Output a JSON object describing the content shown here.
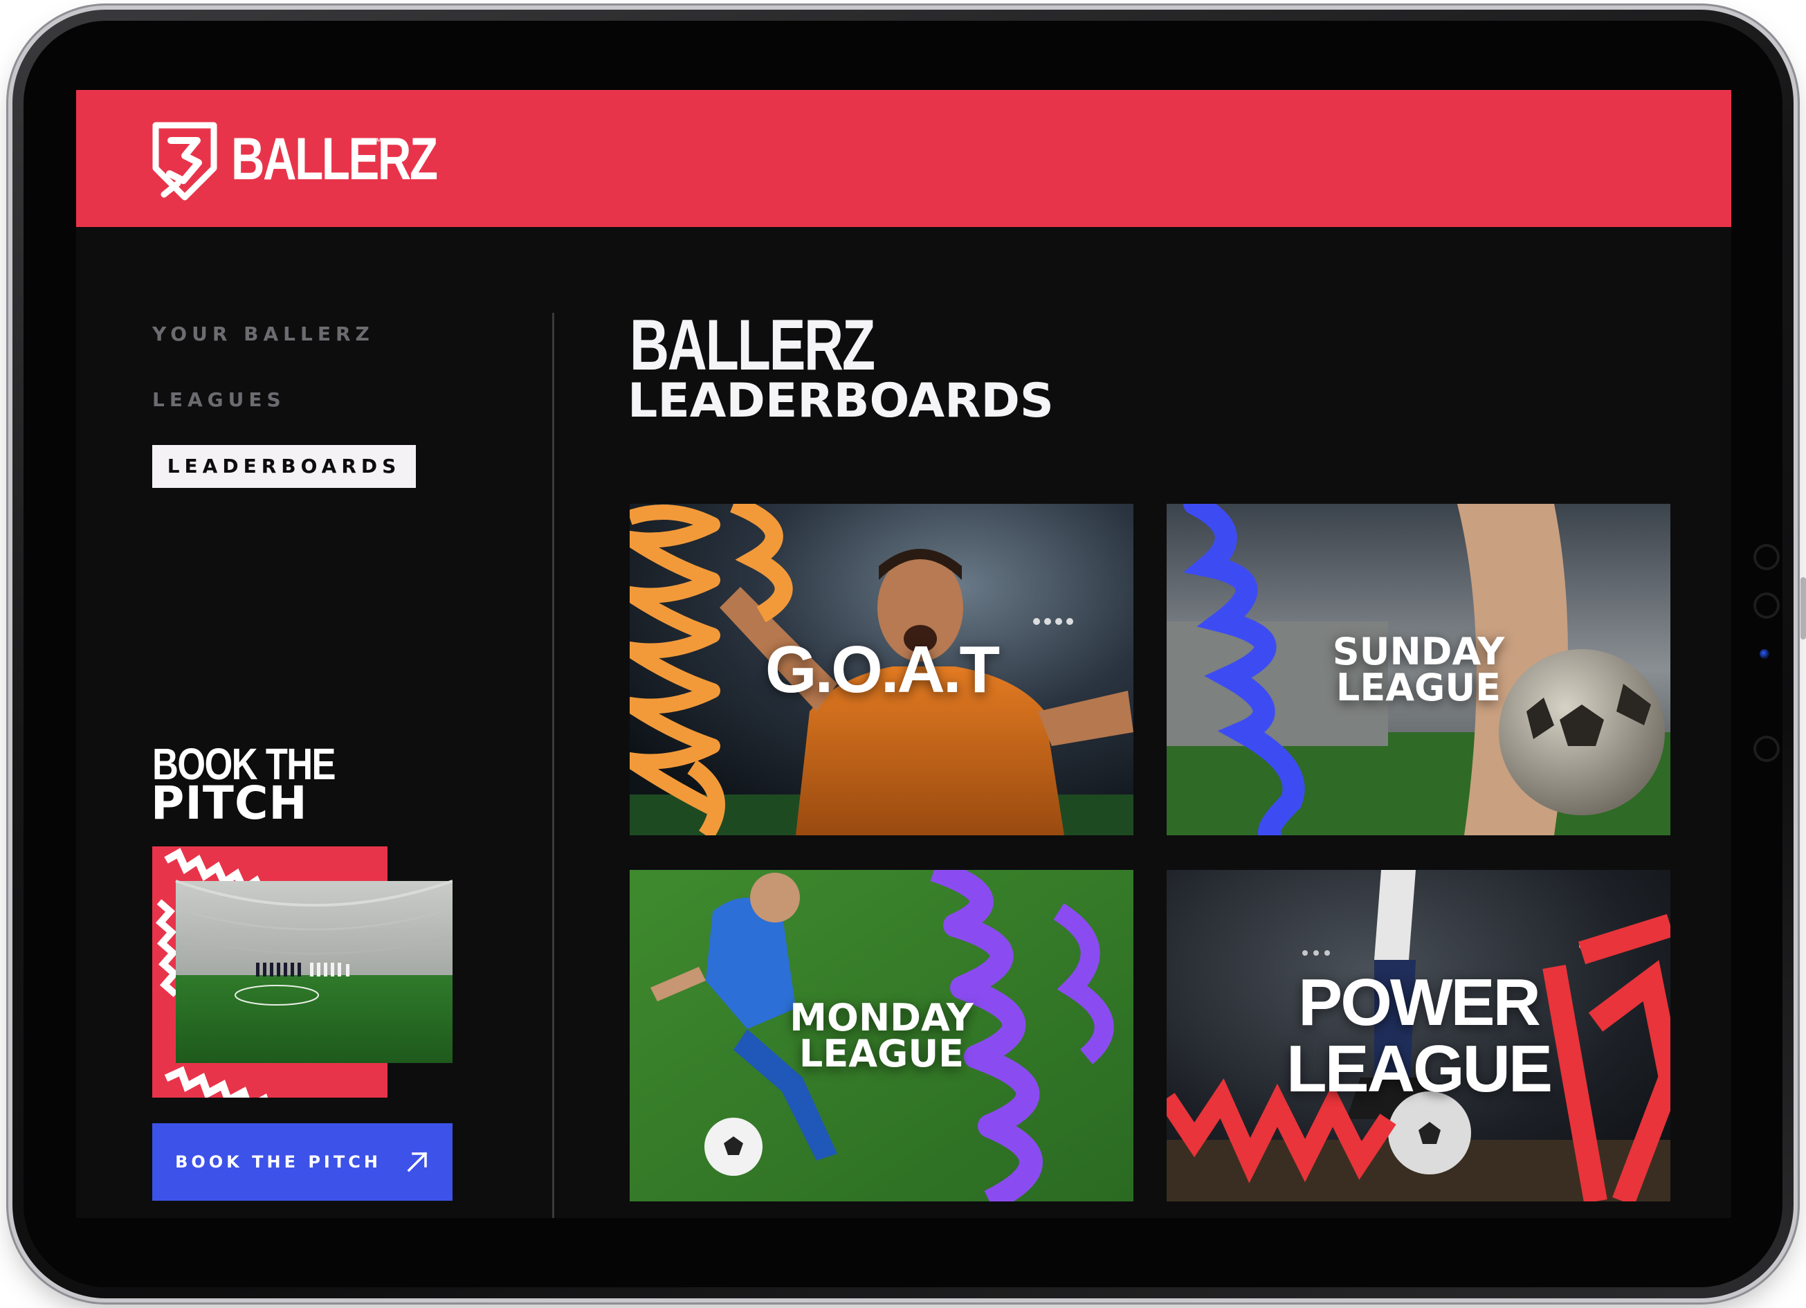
{
  "brand": {
    "name": "BALLERZ",
    "trademark": "™",
    "accent_color": "#e8344a",
    "button_color": "#3d52e8"
  },
  "sidebar": {
    "items": [
      {
        "label": "YOUR BALLERZ",
        "active": false
      },
      {
        "label": "LEAGUES",
        "active": false
      },
      {
        "label": "LEADERBOARDS",
        "active": true
      }
    ],
    "book": {
      "heading_line1": "BOOK THE",
      "heading_line2": "PITCH",
      "button_label": "BOOK THE PITCH",
      "button_icon": "arrow-up-right-icon"
    }
  },
  "main": {
    "title_line1": "BALLERZ",
    "title_line2": "LEADERBOARDS",
    "cards": [
      {
        "label": "G.O.A.T",
        "accent": "#f29a3a"
      },
      {
        "label_line1": "SUNDAY",
        "label_line2": "LEAGUE",
        "accent": "#3d4cf2"
      },
      {
        "label_line1": "MONDAY",
        "label_line2": "LEAGUE",
        "accent": "#8a4cf0"
      },
      {
        "label": "POWER LEAGUE",
        "accent": "#e8343a"
      }
    ]
  }
}
